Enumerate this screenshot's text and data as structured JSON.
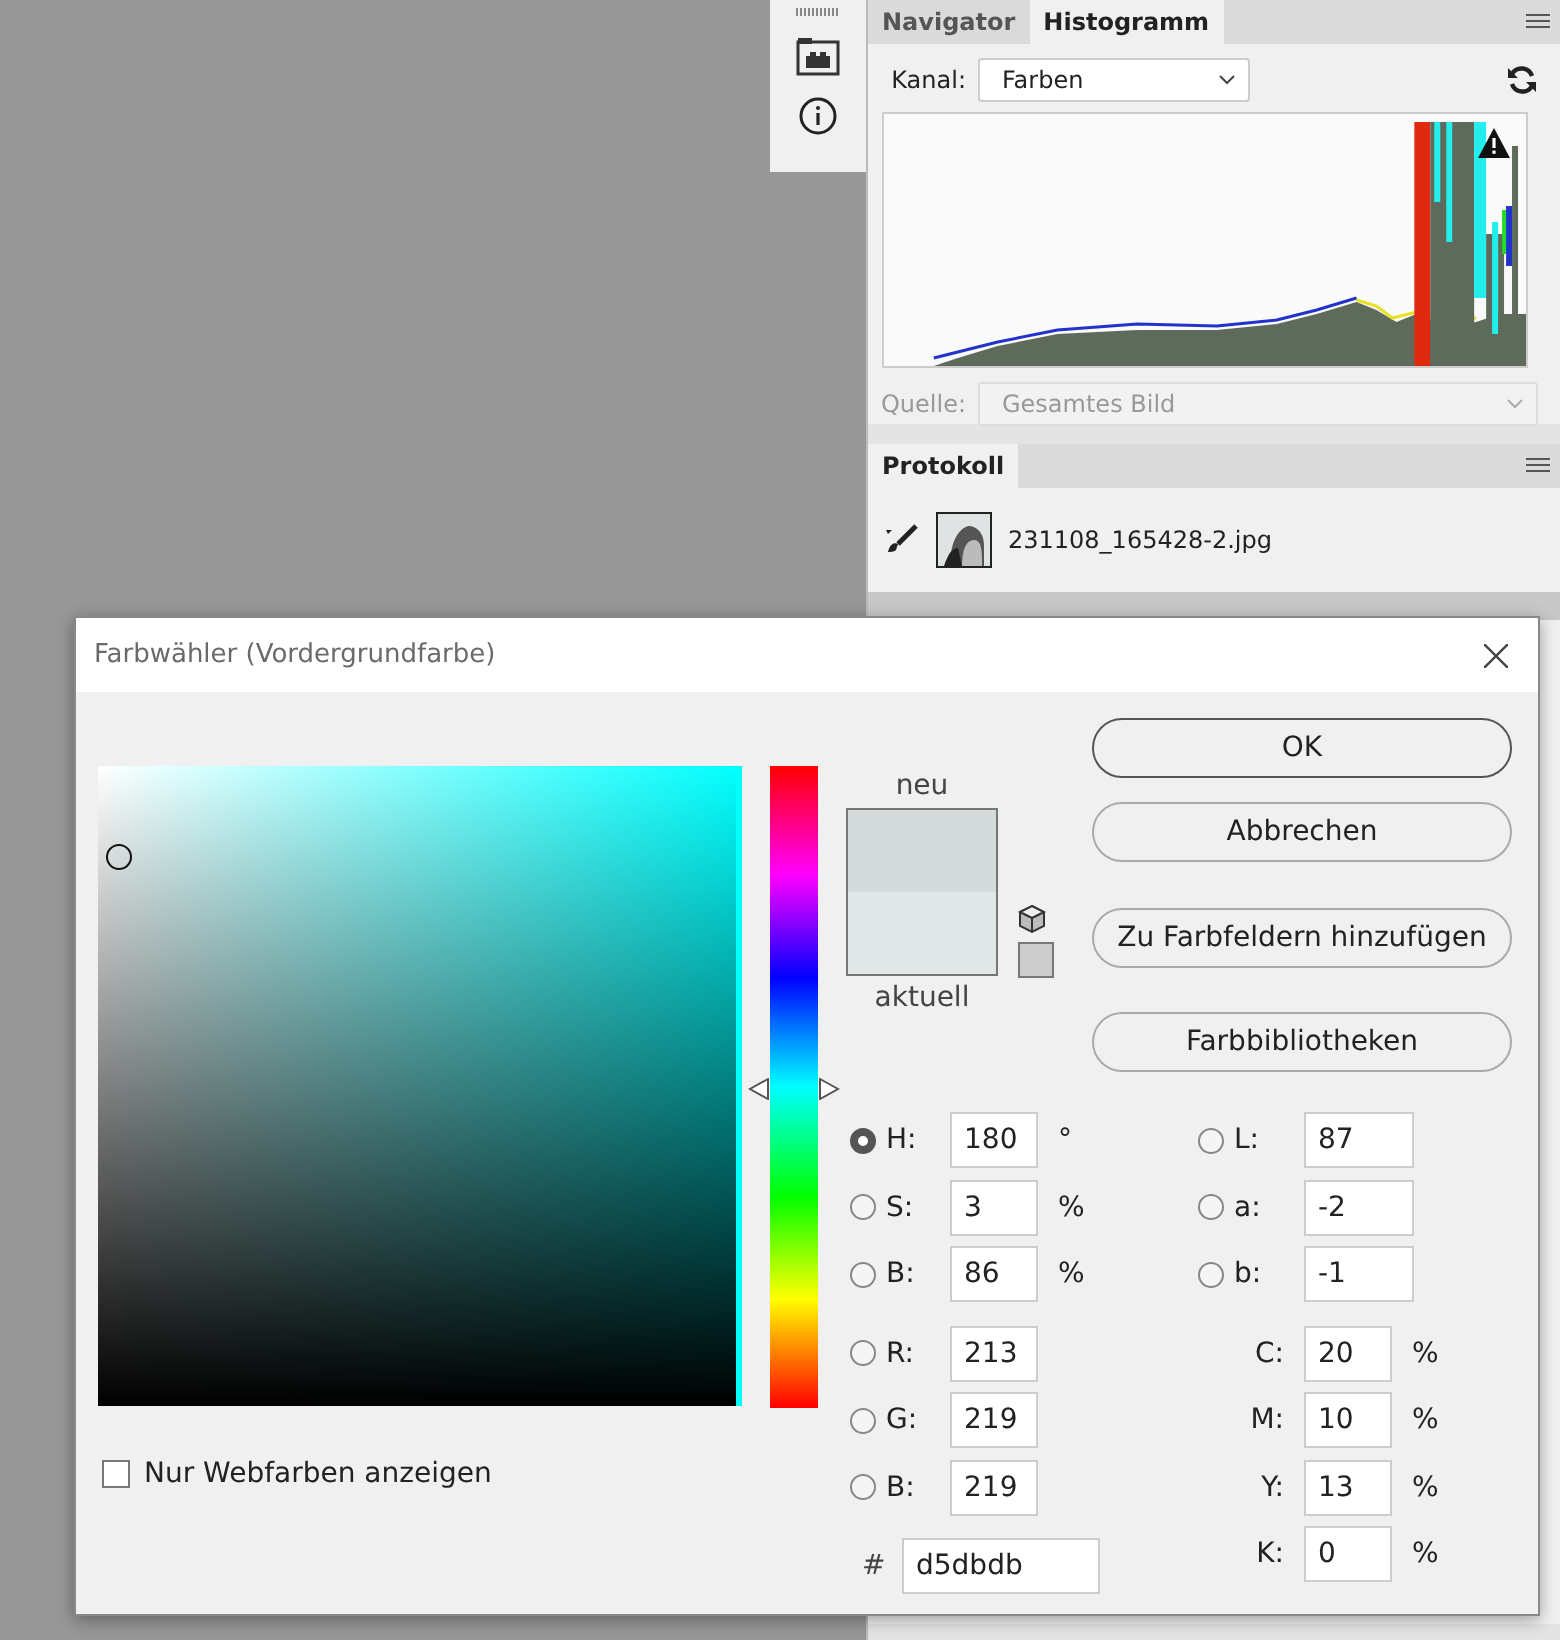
{
  "histogram_panel": {
    "tabs": [
      {
        "label": "Navigator",
        "selected": false
      },
      {
        "label": "Histogramm",
        "selected": true
      }
    ],
    "channel_label": "Kanal:",
    "channel_value": "Farben",
    "source_label": "Quelle:",
    "source_value": "Gesamtes Bild",
    "source_disabled": true
  },
  "history_panel": {
    "tabs": [
      {
        "label": "Protokoll",
        "selected": true
      }
    ],
    "snapshot": "231108_165428-2.jpg"
  },
  "dialog": {
    "title": "Farbwähler (Vordergrundfarbe)",
    "hue": {
      "level": 0.5
    },
    "field_marker": {
      "saturation": {
        "level": 0.03
      },
      "brightness": {
        "level": 0.86
      }
    },
    "swatches": [
      {
        "label": "neu",
        "color": "#d5dbdb"
      },
      {
        "label": "aktuell",
        "color": "#e1e6e6"
      }
    ],
    "buttons": [
      {
        "label": "OK",
        "default": true
      },
      {
        "label": "Abbrechen",
        "default": false
      },
      {
        "label": "Zu Farbfeldern hinzufügen",
        "default": false
      },
      {
        "label": "Farbbibliotheken",
        "default": false
      }
    ],
    "web_only": {
      "label": "Nur Webfarben anzeigen",
      "checked": false
    },
    "left_fields": [
      {
        "kind": "radio",
        "label": "H:",
        "value": "180",
        "unit": "°",
        "selected": true
      },
      {
        "kind": "radio",
        "label": "S:",
        "value": "3",
        "unit": "%",
        "selected": false
      },
      {
        "kind": "radio",
        "label": "B:",
        "value": "86",
        "unit": "%",
        "selected": false
      },
      {
        "kind": "radio",
        "label": "R:",
        "value": "213",
        "selected": false
      },
      {
        "kind": "radio",
        "label": "G:",
        "value": "219",
        "selected": false
      },
      {
        "kind": "radio",
        "label": "B:",
        "value": "219",
        "selected": false
      }
    ],
    "right_fields": [
      {
        "kind": "radio",
        "label": "L:",
        "value": "87",
        "selected": false
      },
      {
        "kind": "radio",
        "label": "a:",
        "value": "-2",
        "selected": false
      },
      {
        "kind": "radio",
        "label": "b:",
        "value": "-1",
        "selected": false
      },
      {
        "kind": "plain",
        "label": "C:",
        "value": "20",
        "unit": "%"
      },
      {
        "kind": "plain",
        "label": "M:",
        "value": "10",
        "unit": "%"
      },
      {
        "kind": "plain",
        "label": "Y:",
        "value": "13",
        "unit": "%"
      },
      {
        "kind": "plain",
        "label": "K:",
        "value": "0",
        "unit": "%"
      }
    ],
    "hex": {
      "label": "#",
      "value": "d5dbdb"
    }
  }
}
